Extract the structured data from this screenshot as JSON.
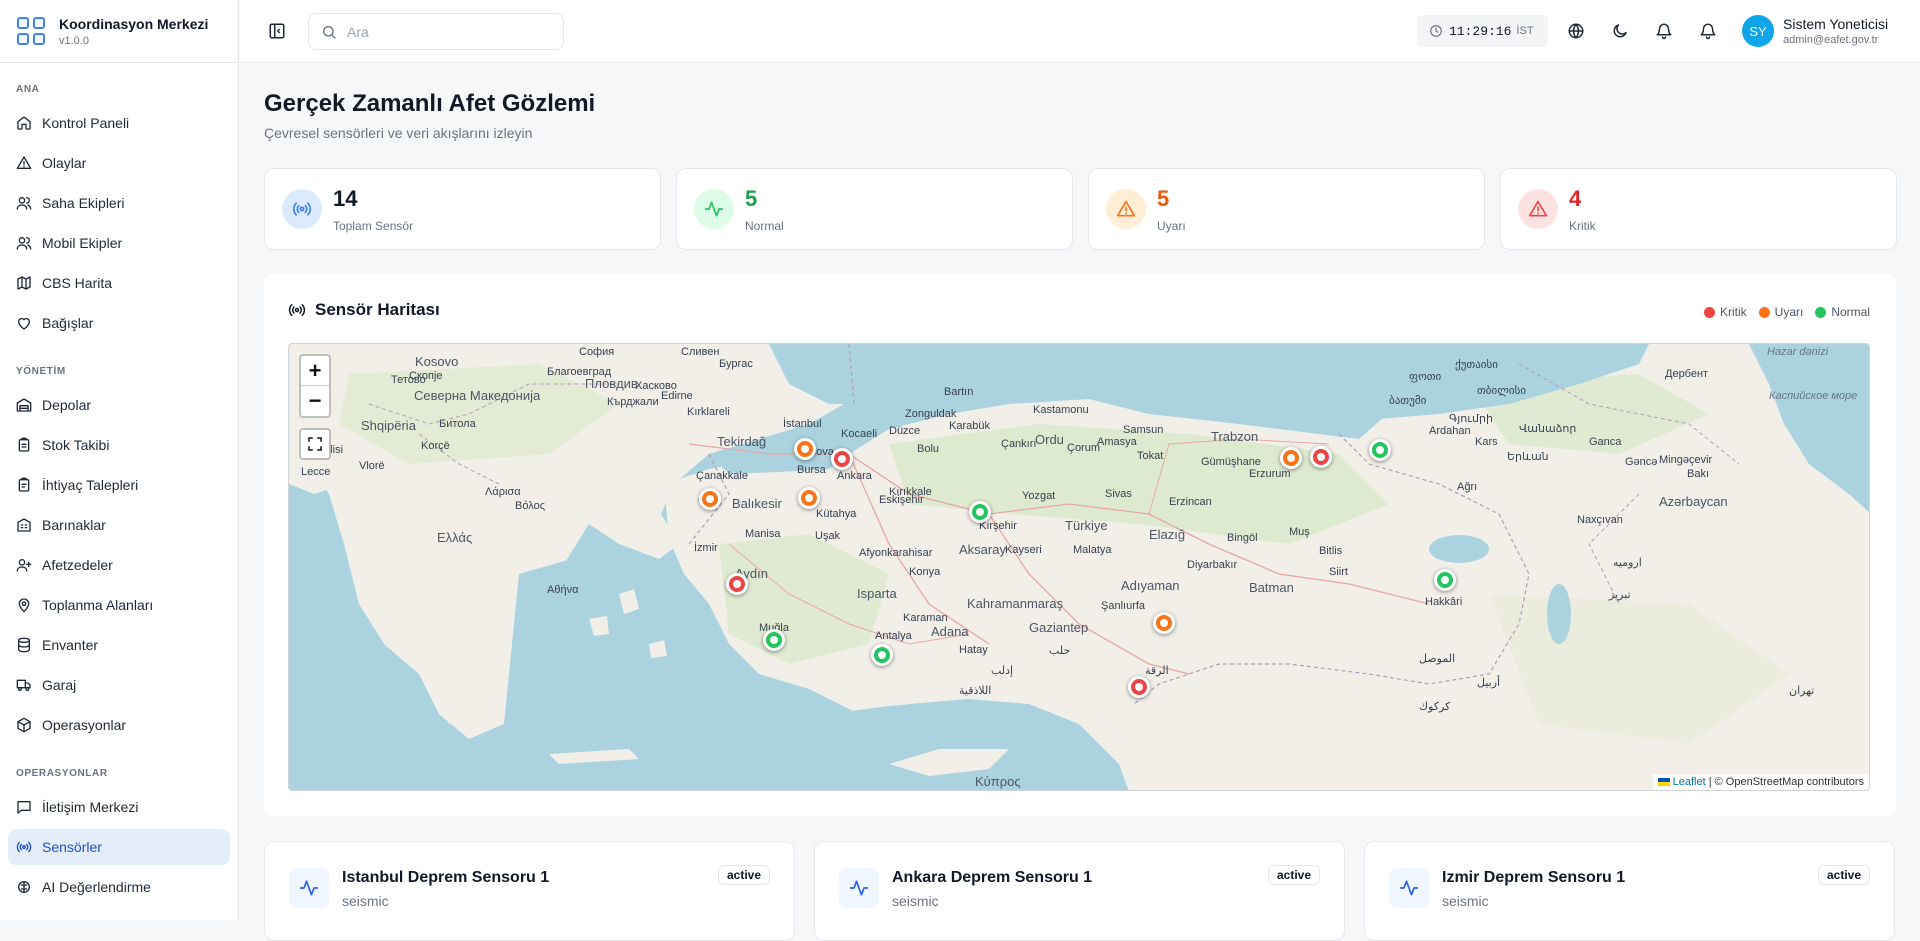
{
  "brand": {
    "title": "Koordinasyon Merkezi",
    "version": "v1.0.0"
  },
  "nav": {
    "sections": [
      {
        "heading": "ANA",
        "items": [
          "Kontrol Paneli",
          "Olaylar",
          "Saha Ekipleri",
          "Mobil Ekipler",
          "CBS Harita",
          "Bağışlar"
        ]
      },
      {
        "heading": "YÖNETİM",
        "items": [
          "Depolar",
          "Stok Takibi",
          "İhtiyaç Talepleri",
          "Barınaklar",
          "Afetzedeler",
          "Toplanma Alanları",
          "Envanter",
          "Garaj",
          "Operasyonlar"
        ]
      },
      {
        "heading": "OPERASYONLAR",
        "items": [
          "İletişim Merkezi",
          "Sensörler",
          "AI Değerlendirme"
        ]
      }
    ],
    "active": "Sensörler"
  },
  "header": {
    "search_placeholder": "Ara",
    "clock_time": "11:29:16",
    "clock_tz": "İST",
    "user_initials": "SY",
    "user_name": "Sistem Yoneticisi",
    "user_email": "admin@eafet.gov.tr"
  },
  "page": {
    "title": "Gerçek Zamanlı Afet Gözlemi",
    "subtitle": "Çevresel sensörleri ve veri akışlarını izleyin"
  },
  "stats": [
    {
      "value": "14",
      "label": "Toplam Sensör",
      "color": "#111827",
      "icon_bg": "#dbeafe",
      "icon_color": "#3b82f6",
      "icon": "radio-icon"
    },
    {
      "value": "5",
      "label": "Normal",
      "color": "#16a34a",
      "icon_bg": "#dcfce7",
      "icon_color": "#22c55e",
      "icon": "activity-icon"
    },
    {
      "value": "5",
      "label": "Uyarı",
      "color": "#ea580c",
      "icon_bg": "#ffedd5",
      "icon_color": "#f97316",
      "icon": "warning-icon"
    },
    {
      "value": "4",
      "label": "Kritik",
      "color": "#dc2626",
      "icon_bg": "#fee2e2",
      "icon_color": "#ef4444",
      "icon": "warning-icon"
    }
  ],
  "map_card": {
    "title": "Sensör Haritası",
    "legend": [
      {
        "label": "Kritik",
        "color": "#ef4444"
      },
      {
        "label": "Uyarı",
        "color": "#f97316"
      },
      {
        "label": "Normal",
        "color": "#22c55e"
      }
    ],
    "zoom_in": "+",
    "zoom_out": "−",
    "attribution_link": "Leaflet",
    "attribution_text": "| © OpenStreetMap contributors"
  },
  "map_labels": {
    "turkiye": "Türkiye",
    "ankara": "Ankara",
    "istanbul": "İstanbul",
    "kocaeli": "Kocaeli",
    "bursa": "Bursa",
    "izmir": "İzmir",
    "aydin": "Aydın",
    "isparta": "Isparta",
    "antalya": "Antalya",
    "mugla": "Muğla",
    "balikesir": "Balıkesir",
    "canakkale": "Çanakkale",
    "tekirdag": "Tekirdağ",
    "yalova": "Yalova",
    "bolu": "Bolu",
    "duzce": "Düzce",
    "zonguldak": "Zonguldak",
    "bartin": "Bartın",
    "karabuk": "Karabük",
    "cankiri": "Çankırı",
    "kirikkale": "Kırıkkale",
    "samsun": "Samsun",
    "amasya": "Amasya",
    "tokat": "Tokat",
    "ordu": "Ordu",
    "trabzon": "Trabzon",
    "gumushane": "Gümüşhane",
    "erzurum": "Erzurum",
    "kars": "Kars",
    "ardahan": "Ardahan",
    "agri": "Ağrı",
    "yozgat": "Yozgat",
    "sivas": "Sivas",
    "kirsehir": "Kırşehir",
    "aksaray": "Aksaray",
    "kayseri": "Kayseri",
    "malatya": "Malatya",
    "elazig": "Elazığ",
    "bingol": "Bingöl",
    "mus": "Muş",
    "bitlis": "Bitlis",
    "batman": "Batman",
    "siirt": "Siirt",
    "hakkari": "Hakkâri",
    "adiyaman": "Adıyaman",
    "kahramanmaras": "Kahramanmaraş",
    "gaziantep": "Gaziantep",
    "adana": "Adana",
    "hatay": "Hatay",
    "karaman": "Karaman",
    "konya": "Konya",
    "usak": "Uşak",
    "kutahya": "Kütahya",
    "eskisehir": "Eskişehir",
    "manisa": "Manisa",
    "afyon": "Afyonkarahisar",
    "diyarbakir": "Diyarbakır",
    "sanliurfa": "Şanlıurfa",
    "erzincan": "Erzincan",
    "kastamonu": "Kastamonu",
    "corum": "Çorum",
    "sofia": "София",
    "plovdiv": "Пловдив",
    "burgas": "Бургас",
    "kardzhali": "Кърджали",
    "haskovo": "Хасково",
    "sliven": "Сливен",
    "edirne": "Edirne",
    "kirklareli": "Kırklareli",
    "kosovo": "Kosovo",
    "skopje": "Скопје",
    "makedonija": "Северна Македонија",
    "shqiperia": "Shqipëria",
    "tetovo": "Тетово",
    "bitola": "Битола",
    "ellada": "Ελλάς",
    "athina": "Αθήνα",
    "korce": "Korçë",
    "vlore": "Vlorë",
    "brindisi": "Brindisi",
    "lecce": "Lecce",
    "larisa": "Λάρισα",
    "volos": "Βόλος",
    "blagoevgrad": "Благоевград",
    "kibris": "Κύπρος",
    "tbilisi": "თბილისი",
    "yerevan": "Երևան",
    "baku": "Bakı",
    "azerbaycan": "Azərbaycan",
    "ganca": "Gəncə",
    "mingacevir": "Mingəçevir",
    "derbent": "Дербент",
    "tabriz": "تبریز",
    "urmia": "ارومیه",
    "mosul": "الموصل",
    "erbil": "أربيل",
    "kirkuk": "كركوك",
    "aleppo": "حلب",
    "raqqa": "الرقة",
    "tehran": "تهران",
    "idlib": "إدلب",
    "latakia": "اللاذقية",
    "hazar": "Hazar dənizi",
    "kaspi": "Каспийское море",
    "nakhchivan": "Naxçıvan",
    "batumi": "ბათუმი",
    "gyumri": "Գյումրի",
    "vanadzor": "Վանաձոր",
    "ganja": "Ganca",
    "kutaisi": "ქუთაისი",
    "poti": "ფოთი"
  },
  "sensors": [
    {
      "name": "Istanbul Deprem Sensoru 1",
      "type": "seismic",
      "status": "active"
    },
    {
      "name": "Ankara Deprem Sensoru 1",
      "type": "seismic",
      "status": "active"
    },
    {
      "name": "Izmir Deprem Sensoru 1",
      "type": "seismic",
      "status": "active"
    }
  ],
  "markers": [
    {
      "status": "critical",
      "color": "#ef4444"
    },
    {
      "status": "warning",
      "color": "#f97316"
    },
    {
      "status": "warning",
      "color": "#f97316"
    },
    {
      "status": "warning",
      "color": "#f97316"
    },
    {
      "status": "critical",
      "color": "#ef4444"
    },
    {
      "status": "normal",
      "color": "#22c55e"
    },
    {
      "status": "warning",
      "color": "#f97316"
    },
    {
      "status": "critical",
      "color": "#ef4444"
    },
    {
      "status": "normal",
      "color": "#22c55e"
    },
    {
      "status": "normal",
      "color": "#22c55e"
    },
    {
      "status": "normal",
      "color": "#22c55e"
    },
    {
      "status": "normal",
      "color": "#22c55e"
    },
    {
      "status": "warning",
      "color": "#f97316"
    },
    {
      "status": "critical",
      "color": "#ef4444"
    }
  ]
}
